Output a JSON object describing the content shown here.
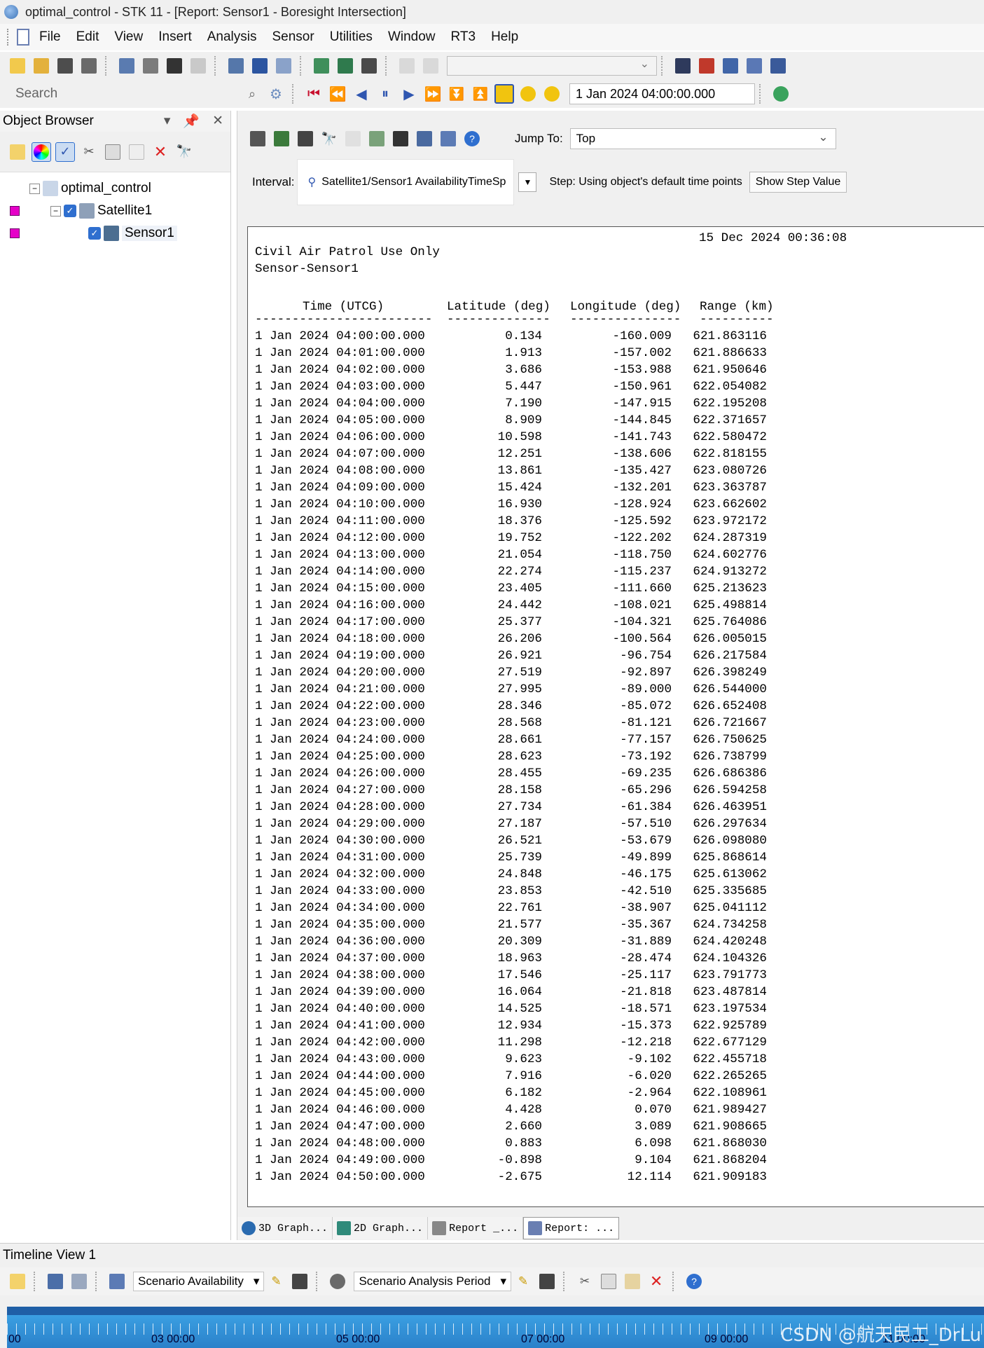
{
  "window": {
    "title": "optimal_control - STK 11 - [Report:  Sensor1 - Boresight Intersection]"
  },
  "menu": [
    "File",
    "Edit",
    "View",
    "Insert",
    "Analysis",
    "Sensor",
    "Utilities",
    "Window",
    "RT3",
    "Help"
  ],
  "toolbar": {
    "search_placeholder": "Search",
    "time_value": "1 Jan 2024 04:00:00.000"
  },
  "object_browser": {
    "title": "Object Browser",
    "items": [
      {
        "label": "optimal_control"
      },
      {
        "label": "Satellite1"
      },
      {
        "label": "Sensor1"
      }
    ]
  },
  "report": {
    "jump_to_label": "Jump To:",
    "jump_to_value": "Top",
    "interval_label": "Interval:",
    "interval_value": "Satellite1/Sensor1 AvailabilityTimeSp",
    "step_label": "Step:  Using object's default time points",
    "show_step_button": "Show Step Value",
    "timestamp": "15 Dec 2024 00:36:08",
    "line1": "Civil Air Patrol Use Only",
    "line2": "Sensor-Sensor1",
    "columns": [
      "Time (UTCG)",
      "Latitude (deg)",
      "Longitude (deg)",
      "Range (km)"
    ],
    "dash_lines": [
      "------------------------",
      "--------------",
      "---------------",
      "----------"
    ],
    "rows": [
      [
        "1 Jan 2024 04:00:00.000",
        "0.134",
        "-160.009",
        "621.863116"
      ],
      [
        "1 Jan 2024 04:01:00.000",
        "1.913",
        "-157.002",
        "621.886633"
      ],
      [
        "1 Jan 2024 04:02:00.000",
        "3.686",
        "-153.988",
        "621.950646"
      ],
      [
        "1 Jan 2024 04:03:00.000",
        "5.447",
        "-150.961",
        "622.054082"
      ],
      [
        "1 Jan 2024 04:04:00.000",
        "7.190",
        "-147.915",
        "622.195208"
      ],
      [
        "1 Jan 2024 04:05:00.000",
        "8.909",
        "-144.845",
        "622.371657"
      ],
      [
        "1 Jan 2024 04:06:00.000",
        "10.598",
        "-141.743",
        "622.580472"
      ],
      [
        "1 Jan 2024 04:07:00.000",
        "12.251",
        "-138.606",
        "622.818155"
      ],
      [
        "1 Jan 2024 04:08:00.000",
        "13.861",
        "-135.427",
        "623.080726"
      ],
      [
        "1 Jan 2024 04:09:00.000",
        "15.424",
        "-132.201",
        "623.363787"
      ],
      [
        "1 Jan 2024 04:10:00.000",
        "16.930",
        "-128.924",
        "623.662602"
      ],
      [
        "1 Jan 2024 04:11:00.000",
        "18.376",
        "-125.592",
        "623.972172"
      ],
      [
        "1 Jan 2024 04:12:00.000",
        "19.752",
        "-122.202",
        "624.287319"
      ],
      [
        "1 Jan 2024 04:13:00.000",
        "21.054",
        "-118.750",
        "624.602776"
      ],
      [
        "1 Jan 2024 04:14:00.000",
        "22.274",
        "-115.237",
        "624.913272"
      ],
      [
        "1 Jan 2024 04:15:00.000",
        "23.405",
        "-111.660",
        "625.213623"
      ],
      [
        "1 Jan 2024 04:16:00.000",
        "24.442",
        "-108.021",
        "625.498814"
      ],
      [
        "1 Jan 2024 04:17:00.000",
        "25.377",
        "-104.321",
        "625.764086"
      ],
      [
        "1 Jan 2024 04:18:00.000",
        "26.206",
        "-100.564",
        "626.005015"
      ],
      [
        "1 Jan 2024 04:19:00.000",
        "26.921",
        "-96.754",
        "626.217584"
      ],
      [
        "1 Jan 2024 04:20:00.000",
        "27.519",
        "-92.897",
        "626.398249"
      ],
      [
        "1 Jan 2024 04:21:00.000",
        "27.995",
        "-89.000",
        "626.544000"
      ],
      [
        "1 Jan 2024 04:22:00.000",
        "28.346",
        "-85.072",
        "626.652408"
      ],
      [
        "1 Jan 2024 04:23:00.000",
        "28.568",
        "-81.121",
        "626.721667"
      ],
      [
        "1 Jan 2024 04:24:00.000",
        "28.661",
        "-77.157",
        "626.750625"
      ],
      [
        "1 Jan 2024 04:25:00.000",
        "28.623",
        "-73.192",
        "626.738799"
      ],
      [
        "1 Jan 2024 04:26:00.000",
        "28.455",
        "-69.235",
        "626.686386"
      ],
      [
        "1 Jan 2024 04:27:00.000",
        "28.158",
        "-65.296",
        "626.594258"
      ],
      [
        "1 Jan 2024 04:28:00.000",
        "27.734",
        "-61.384",
        "626.463951"
      ],
      [
        "1 Jan 2024 04:29:00.000",
        "27.187",
        "-57.510",
        "626.297634"
      ],
      [
        "1 Jan 2024 04:30:00.000",
        "26.521",
        "-53.679",
        "626.098080"
      ],
      [
        "1 Jan 2024 04:31:00.000",
        "25.739",
        "-49.899",
        "625.868614"
      ],
      [
        "1 Jan 2024 04:32:00.000",
        "24.848",
        "-46.175",
        "625.613062"
      ],
      [
        "1 Jan 2024 04:33:00.000",
        "23.853",
        "-42.510",
        "625.335685"
      ],
      [
        "1 Jan 2024 04:34:00.000",
        "22.761",
        "-38.907",
        "625.041112"
      ],
      [
        "1 Jan 2024 04:35:00.000",
        "21.577",
        "-35.367",
        "624.734258"
      ],
      [
        "1 Jan 2024 04:36:00.000",
        "20.309",
        "-31.889",
        "624.420248"
      ],
      [
        "1 Jan 2024 04:37:00.000",
        "18.963",
        "-28.474",
        "624.104326"
      ],
      [
        "1 Jan 2024 04:38:00.000",
        "17.546",
        "-25.117",
        "623.791773"
      ],
      [
        "1 Jan 2024 04:39:00.000",
        "16.064",
        "-21.818",
        "623.487814"
      ],
      [
        "1 Jan 2024 04:40:00.000",
        "14.525",
        "-18.571",
        "623.197534"
      ],
      [
        "1 Jan 2024 04:41:00.000",
        "12.934",
        "-15.373",
        "622.925789"
      ],
      [
        "1 Jan 2024 04:42:00.000",
        "11.298",
        "-12.218",
        "622.677129"
      ],
      [
        "1 Jan 2024 04:43:00.000",
        "9.623",
        "-9.102",
        "622.455718"
      ],
      [
        "1 Jan 2024 04:44:00.000",
        "7.916",
        "-6.020",
        "622.265265"
      ],
      [
        "1 Jan 2024 04:45:00.000",
        "6.182",
        "-2.964",
        "622.108961"
      ],
      [
        "1 Jan 2024 04:46:00.000",
        "4.428",
        "0.070",
        "621.989427"
      ],
      [
        "1 Jan 2024 04:47:00.000",
        "2.660",
        "3.089",
        "621.908665"
      ],
      [
        "1 Jan 2024 04:48:00.000",
        "0.883",
        "6.098",
        "621.868030"
      ],
      [
        "1 Jan 2024 04:49:00.000",
        "-0.898",
        "9.104",
        "621.868204"
      ],
      [
        "1 Jan 2024 04:50:00.000",
        "-2.675",
        "12.114",
        "621.909183"
      ]
    ]
  },
  "bottom_tabs": [
    "3D Graph...",
    "2D Graph...",
    "Report _...",
    "Report: ..."
  ],
  "timeline": {
    "title": "Timeline View 1",
    "combo1": "Scenario Availability",
    "combo2": "Scenario Analysis Period",
    "ticks": [
      "00",
      "03 00:00",
      "05 00:00",
      "07 00:00",
      "09 00:00",
      "11 00:00"
    ]
  },
  "watermark": "CSDN @航天民工_DrLu"
}
